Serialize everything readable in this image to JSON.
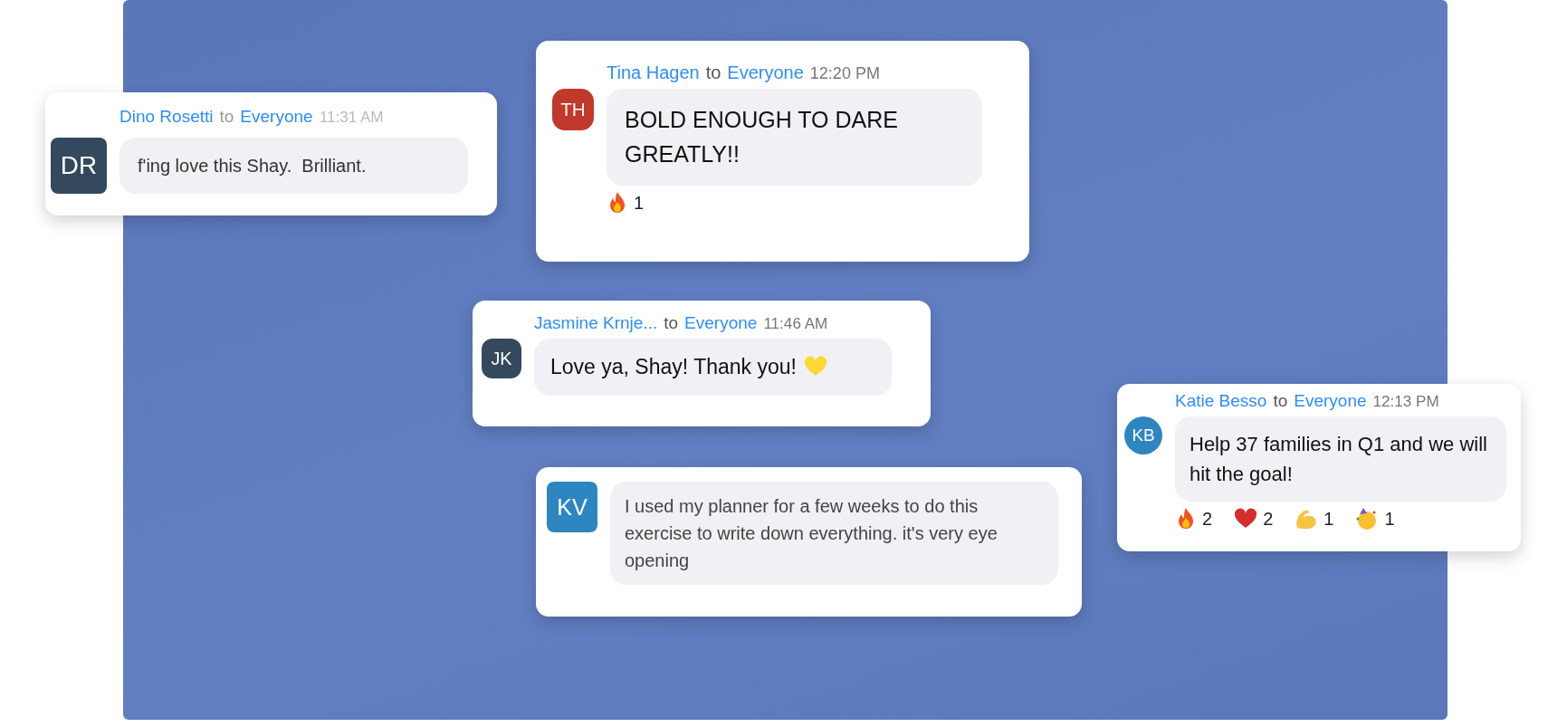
{
  "messages": [
    {
      "sender": "Dino Rosetti",
      "to": "to",
      "recipient": "Everyone",
      "time": "11:31 AM",
      "initials": "DR",
      "color": "#34495e",
      "text": "f'ing love this Shay.  Brilliant."
    },
    {
      "sender": "Tina Hagen",
      "to": "to",
      "recipient": "Everyone",
      "time": "12:20 PM",
      "initials": "TH",
      "color": "#c0392b",
      "text": "BOLD ENOUGH TO DARE GREATLY!!",
      "reactions": [
        {
          "kind": "fire",
          "count": "1"
        }
      ]
    },
    {
      "sender": "Jasmine Krnje...",
      "to": "to",
      "recipient": "Everyone",
      "time": "11:46 AM",
      "initials": "JK",
      "color": "#34495e",
      "text": "Love ya, Shay! Thank you!",
      "trailing": {
        "kind": "yellow_heart"
      }
    },
    {
      "initials": "KV",
      "color": "#2e86c1",
      "text": "I used my planner for a few weeks to do this exercise to write down everything. it's very eye opening"
    },
    {
      "sender": "Katie Besso",
      "to": "to",
      "recipient": "Everyone",
      "time": "12:13 PM",
      "initials": "KB",
      "color": "#2e86c1",
      "text": "Help 37 families in Q1 and we will hit the goal!",
      "reactions": [
        {
          "kind": "fire",
          "count": "2"
        },
        {
          "kind": "heart",
          "count": "2"
        },
        {
          "kind": "muscle",
          "count": "1"
        },
        {
          "kind": "party",
          "count": "1"
        }
      ]
    }
  ]
}
